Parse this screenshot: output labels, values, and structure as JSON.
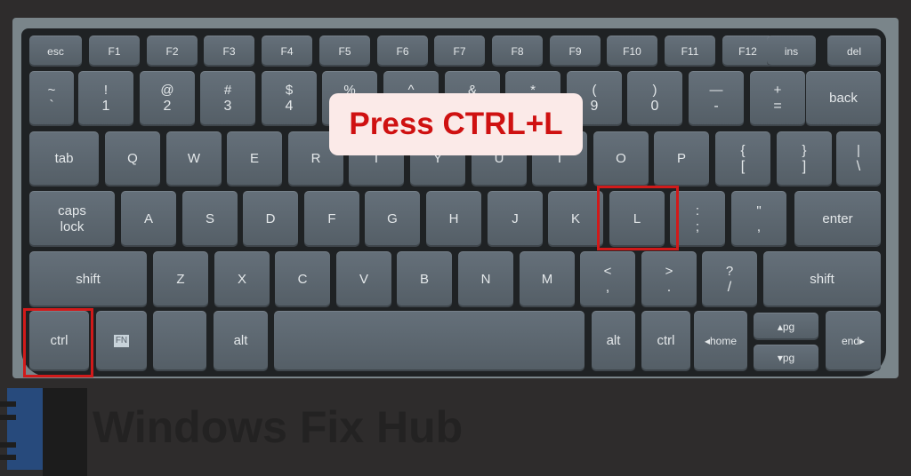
{
  "keyboard": {
    "rows": [
      [
        {
          "label": "esc"
        },
        {
          "label": "F1"
        },
        {
          "label": "F2"
        },
        {
          "label": "F3"
        },
        {
          "label": "F4"
        },
        {
          "label": "F5"
        },
        {
          "label": "F6"
        },
        {
          "label": "F7"
        },
        {
          "label": "F8"
        },
        {
          "label": "F9"
        },
        {
          "label": "F10"
        },
        {
          "label": "F11"
        },
        {
          "label": "F12"
        },
        {
          "label": "ins"
        },
        {
          "label": "del"
        }
      ],
      [
        {
          "top": "~",
          "bottom": "`"
        },
        {
          "top": "!",
          "bottom": "1"
        },
        {
          "top": "@",
          "bottom": "2"
        },
        {
          "top": "#",
          "bottom": "3"
        },
        {
          "top": "$",
          "bottom": "4"
        },
        {
          "top": "%",
          "bottom": "5"
        },
        {
          "top": "^",
          "bottom": "6"
        },
        {
          "top": "&",
          "bottom": "7"
        },
        {
          "top": "*",
          "bottom": "8"
        },
        {
          "top": "(",
          "bottom": "9"
        },
        {
          "top": ")",
          "bottom": "0"
        },
        {
          "top": "—",
          "bottom": "-"
        },
        {
          "top": "+",
          "bottom": "="
        },
        {
          "label": "back"
        }
      ],
      [
        {
          "label": "tab"
        },
        {
          "label": "Q"
        },
        {
          "label": "W"
        },
        {
          "label": "E"
        },
        {
          "label": "R"
        },
        {
          "label": "T"
        },
        {
          "label": "Y"
        },
        {
          "label": "U"
        },
        {
          "label": "I"
        },
        {
          "label": "O"
        },
        {
          "label": "P"
        },
        {
          "top": "{",
          "bottom": "["
        },
        {
          "top": "}",
          "bottom": "]"
        },
        {
          "top": "|",
          "bottom": "\\"
        }
      ],
      [
        {
          "top": "caps",
          "bottom": "lock"
        },
        {
          "label": "A"
        },
        {
          "label": "S"
        },
        {
          "label": "D"
        },
        {
          "label": "F"
        },
        {
          "label": "G"
        },
        {
          "label": "H"
        },
        {
          "label": "J"
        },
        {
          "label": "K"
        },
        {
          "label": "L"
        },
        {
          "top": ":",
          "bottom": ";"
        },
        {
          "top": "\"",
          "bottom": ","
        },
        {
          "label": "enter"
        }
      ],
      [
        {
          "label": "shift"
        },
        {
          "label": "Z"
        },
        {
          "label": "X"
        },
        {
          "label": "C"
        },
        {
          "label": "V"
        },
        {
          "label": "B"
        },
        {
          "label": "N"
        },
        {
          "label": "M"
        },
        {
          "top": "<",
          "bottom": ","
        },
        {
          "top": ">",
          "bottom": "."
        },
        {
          "top": "?",
          "bottom": "/"
        },
        {
          "label": "shift"
        }
      ],
      [
        {
          "label": "ctrl"
        },
        {
          "label": "FN"
        },
        {
          "label": ""
        },
        {
          "label": "alt"
        },
        {
          "label": ""
        },
        {
          "label": "alt"
        },
        {
          "label": "ctrl"
        },
        {
          "label": "◂home"
        },
        {
          "label": "▴pg"
        },
        {
          "label": "▾pg"
        },
        {
          "label": "end▸"
        }
      ]
    ]
  },
  "callout": {
    "text": "Press CTRL+L",
    "color": "#cf1111",
    "background": "#fbeae8"
  },
  "highlights": {
    "keys": [
      "ctrl",
      "L"
    ],
    "color": "#d11a1a"
  },
  "brand": {
    "name": "Windows Fix Hub"
  }
}
